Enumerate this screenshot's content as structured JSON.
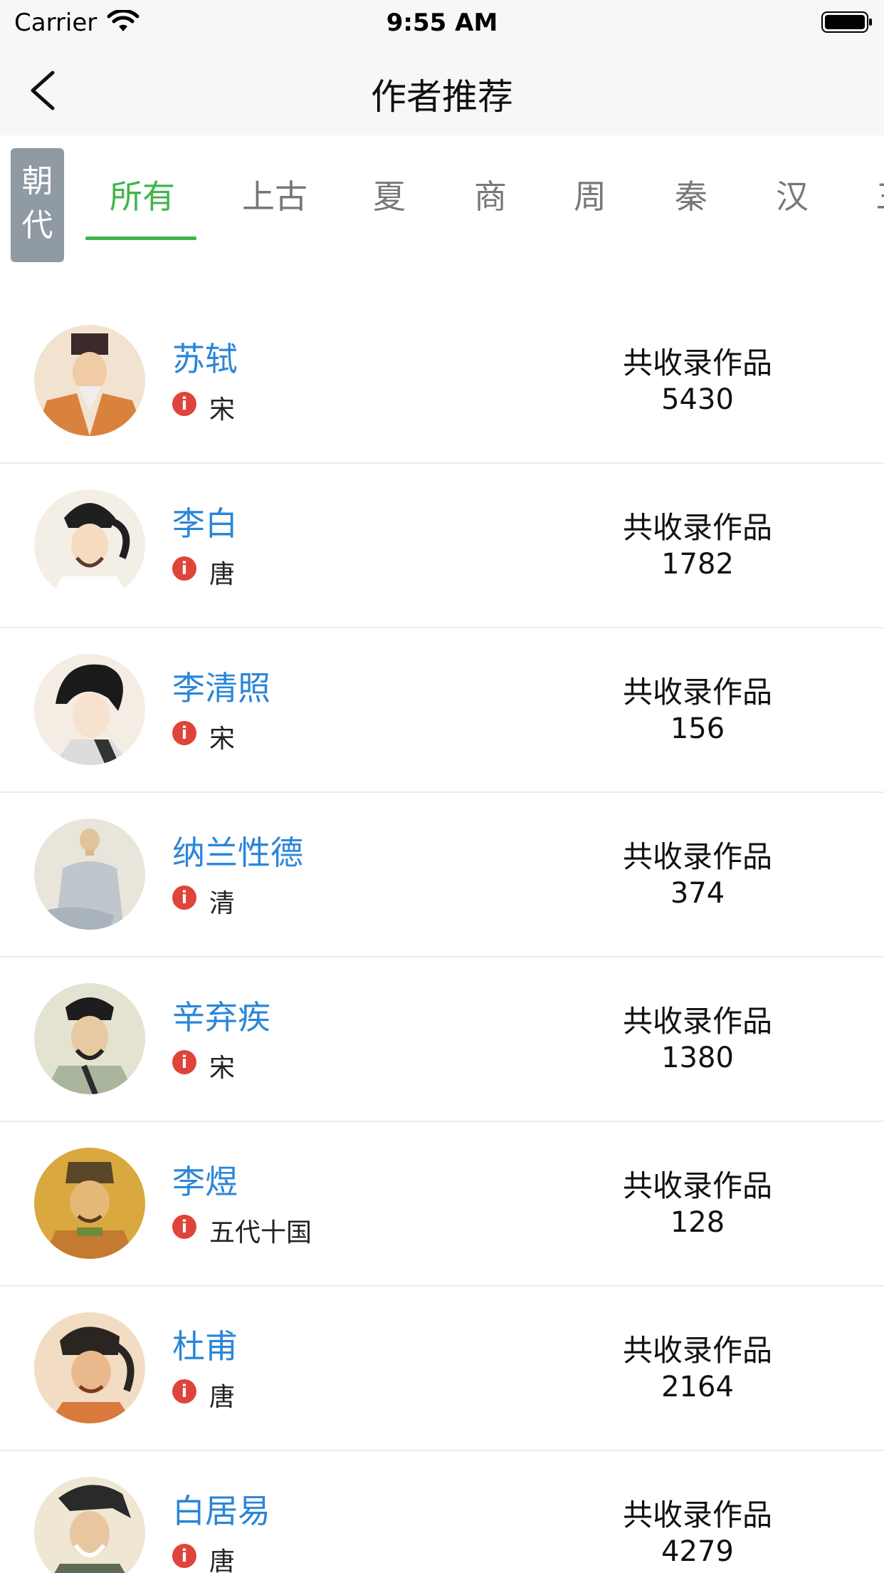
{
  "status_bar": {
    "carrier": "Carrier",
    "time": "9:55 AM"
  },
  "nav": {
    "title": "作者推荐",
    "back_icon": "chevron-left-icon"
  },
  "dynasty_filter": {
    "label_line1": "朝",
    "label_line2": "代",
    "tabs": [
      {
        "label": "所有",
        "active": true
      },
      {
        "label": "上古"
      },
      {
        "label": "夏"
      },
      {
        "label": "商"
      },
      {
        "label": "周"
      },
      {
        "label": "秦"
      },
      {
        "label": "汉"
      },
      {
        "label": "三"
      }
    ],
    "active_color": "#3fb54a"
  },
  "works_label": "共收录作品",
  "authors": [
    {
      "name": "苏轼",
      "dynasty": "宋",
      "count": "5430"
    },
    {
      "name": "李白",
      "dynasty": "唐",
      "count": "1782"
    },
    {
      "name": "李清照",
      "dynasty": "宋",
      "count": "156"
    },
    {
      "name": "纳兰性德",
      "dynasty": "清",
      "count": "374"
    },
    {
      "name": "辛弃疾",
      "dynasty": "宋",
      "count": "1380"
    },
    {
      "name": "李煜",
      "dynasty": "五代十国",
      "count": "128"
    },
    {
      "name": "杜甫",
      "dynasty": "唐",
      "count": "2164"
    },
    {
      "name": "白居易",
      "dynasty": "唐",
      "count": "4279"
    }
  ],
  "colors": {
    "name": "#2a86d9",
    "info": "#e0433a",
    "nav_bg": "#f7f7f7",
    "dynasty_label_bg": "#8f9aa3"
  }
}
